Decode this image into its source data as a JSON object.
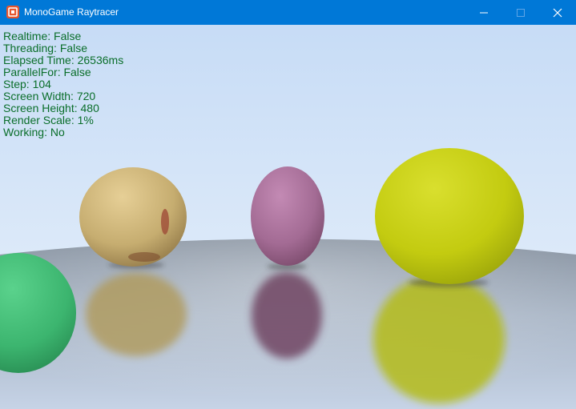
{
  "window": {
    "title": "MonoGame Raytracer",
    "icon": "monogame-icon",
    "controls": {
      "minimize": "minimize-icon",
      "maximize": "maximize-icon",
      "close": "close-icon"
    },
    "titlebar_color": "#0078d7"
  },
  "overlay": {
    "text_color": "#0a6e2a",
    "lines": [
      "Realtime: False",
      "Threading: False",
      "Elapsed Time: 26536ms",
      "ParallelFor: False",
      "Step: 104",
      "Screen Width: 720",
      "Screen Height: 480",
      "Render Scale: 1%",
      "Working: No"
    ]
  },
  "scene": {
    "sky_colors": [
      "#c7dcf6",
      "#e8f1fb"
    ],
    "floor_colors": [
      "#8a96a6",
      "#c4d0e2"
    ],
    "spheres": [
      {
        "name": "green",
        "color": "#3dbb74"
      },
      {
        "name": "gold",
        "color": "#c9b172"
      },
      {
        "name": "pink",
        "color": "#a86f98"
      },
      {
        "name": "yellow",
        "color": "#c4cc12"
      }
    ]
  }
}
